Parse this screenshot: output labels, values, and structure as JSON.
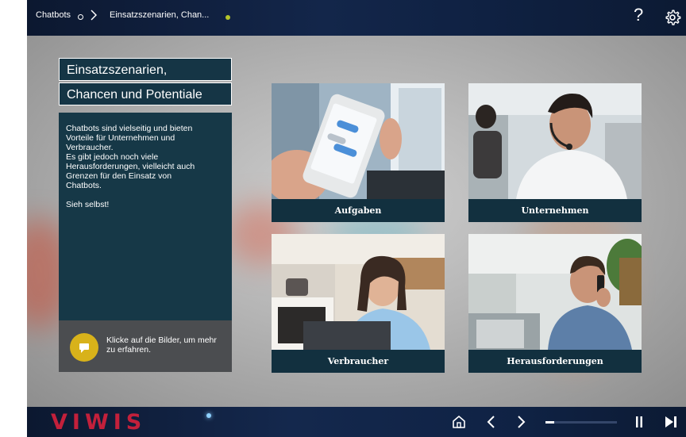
{
  "header": {
    "breadcrumb_root": "Chatbots",
    "breadcrumb_current": "Einsatzszenarien, Chan...",
    "help_label": "?",
    "status_color": "#b5c52a"
  },
  "title": {
    "line1": "Einsatzszenarien,",
    "line2": "Chancen und Potentiale"
  },
  "description": {
    "lines": [
      "Chatbots sind vielseitig und bieten",
      "Vorteile für Unternehmen und",
      "Verbraucher.",
      "Es gibt jedoch noch viele",
      "Herausforderungen, vielleicht auch",
      "Grenzen für den Einsatz von",
      "Chatbots.",
      "",
      "Sieh selbst!"
    ]
  },
  "hint": {
    "text": "Klicke auf die Bilder, um mehr zu erfahren.",
    "icon": "speech-bubble-icon"
  },
  "tiles": [
    {
      "label": "Aufgaben",
      "image": "smartphone-chat-photo"
    },
    {
      "label": "Unternehmen",
      "image": "call-center-agent-photo"
    },
    {
      "label": "Verbraucher",
      "image": "woman-with-laptop-photo"
    },
    {
      "label": "Herausforderungen",
      "image": "man-on-phone-photo"
    }
  ],
  "footer": {
    "logo": "VIWIS",
    "progress": 0.12,
    "icons": [
      "home-icon",
      "prev-icon",
      "next-icon",
      "pause-icon",
      "skip-icon"
    ]
  },
  "colors": {
    "accent": "#d8b21a",
    "brand": "#c3203b",
    "panel": "#163847"
  }
}
